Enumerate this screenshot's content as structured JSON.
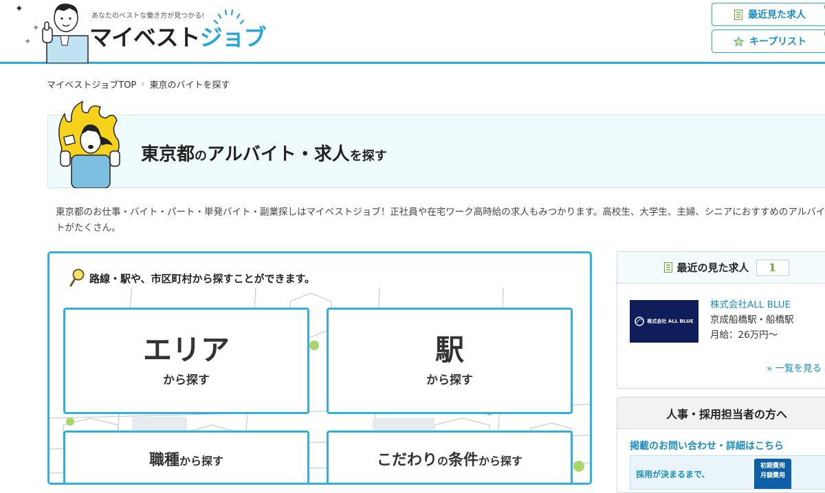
{
  "header": {
    "tagline": "あなたのベストな働き方が見つかる!",
    "logo_dark": "マイベスト",
    "logo_blue": "ジョブ",
    "recent_button": "最近見た求人",
    "keep_button": "キープリスト"
  },
  "breadcrumb": {
    "home": "マイベストジョブTOP",
    "separator": "›",
    "current": "東京のバイトを探す"
  },
  "hero": {
    "region": "東京都",
    "particle1": "の",
    "main": "アルバイト・求人",
    "suffix": "を探す"
  },
  "description": "東京都のお仕事・バイト・パート・単発バイト・副業探しはマイベストジョブ！正社員や在宅ワーク高時給の求人もみつかります。高校生、大学生、主婦、シニアにおすすめのアルバイトがたくさん。",
  "search": {
    "title": "路線・駅や、市区町村から探すことができます。",
    "area_big": "エリア",
    "area_sub": "から探す",
    "station_big": "駅",
    "station_sub": "から探す",
    "job_big": "職種",
    "job_sub": "から探す",
    "cond_big1": "こだわり",
    "cond_mid": "の",
    "cond_big2": "条件",
    "cond_sub": "から探す"
  },
  "recent_jobs": {
    "title": "最近の見た求人",
    "count": "1",
    "items": [
      {
        "logo_text": "株式会社 ALL BLUE",
        "company": "株式会社ALL BLUE",
        "station": "京成船橋駅・船橋駅",
        "salary": "月給：26万円～"
      }
    ],
    "more": "» 一覧を見る"
  },
  "employer": {
    "title": "人事・採用担当者の方へ",
    "link": "掲載のお問い合わせ・詳細はこちら",
    "banner_text": "採用が決まるまで、",
    "banner_badge_1": "初期費用",
    "banner_badge_2": "月額費用"
  },
  "colors": {
    "accent": "#29a8d8",
    "link": "#1a8cc4",
    "green": "#6aa531",
    "hero_bg": "#f0fbfd"
  }
}
